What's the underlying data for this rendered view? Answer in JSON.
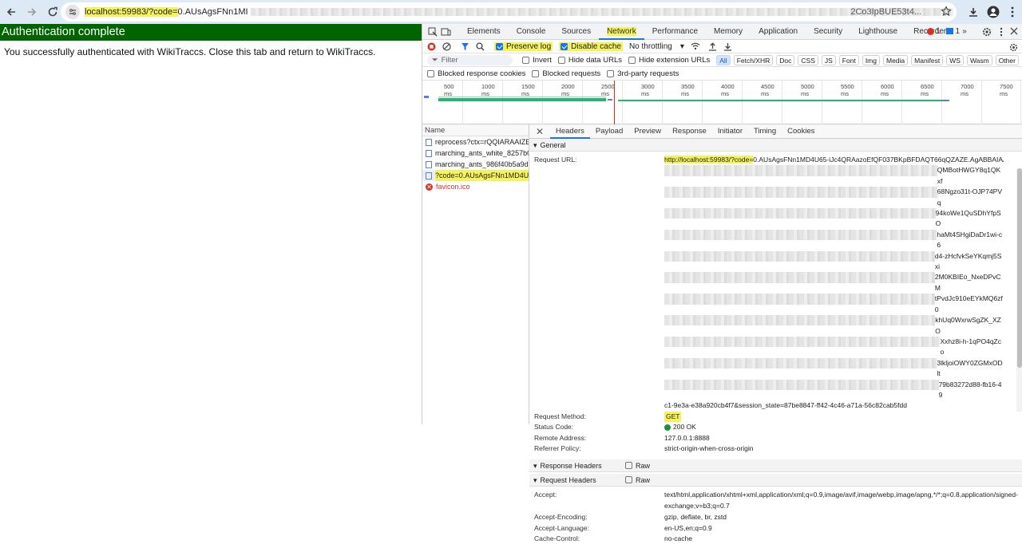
{
  "browser": {
    "url_highlight": "localhost:59983/?code=",
    "url_rest": "0.AUsAgsFNn1MI",
    "url_tail": "2Co3IpBUE53t4..."
  },
  "page": {
    "title": "Authentication complete",
    "message": "You successfully authenticated with WikiTraccs. Close this tab and return to WikiTraccs."
  },
  "devtools": {
    "tabs": [
      "Elements",
      "Console",
      "Sources",
      "Network",
      "Performance",
      "Memory",
      "Application",
      "Security",
      "Lighthouse",
      "Recorder"
    ],
    "active_tab": "Network",
    "more": "»",
    "errors": "1",
    "messages": "1",
    "toolbar": {
      "preserve_log": "Preserve log",
      "disable_cache": "Disable cache",
      "throttling": "No throttling"
    },
    "filter": {
      "placeholder": "Filter",
      "invert": "Invert",
      "hide_data_urls": "Hide data URLs",
      "hide_extension_urls": "Hide extension URLs",
      "types": [
        "All",
        "Fetch/XHR",
        "Doc",
        "CSS",
        "JS",
        "Font",
        "Img",
        "Media",
        "Manifest",
        "WS",
        "Wasm",
        "Other"
      ]
    },
    "options": {
      "blocked_cookies": "Blocked response cookies",
      "blocked_requests": "Blocked requests",
      "third_party": "3rd-party requests"
    },
    "timeline_ticks": [
      "500 ms",
      "1000 ms",
      "1500 ms",
      "2000 ms",
      "2500 ms",
      "3000 ms",
      "3500 ms",
      "4000 ms",
      "4500 ms",
      "5000 ms",
      "5500 ms",
      "6000 ms",
      "6500 ms",
      "7000 ms",
      "7500 ms"
    ],
    "request_list": {
      "header": "Name",
      "items": [
        {
          "name": "reprocess?ctx=rQQIARAAIZE9...",
          "type": "doc"
        },
        {
          "name": "marching_ants_white_8257b07...",
          "type": "doc"
        },
        {
          "name": "marching_ants_986f40b5a9dc7...",
          "type": "doc"
        },
        {
          "name": "?code=0.AUsAgsFNn1MD4U6...",
          "type": "doc",
          "selected": true
        },
        {
          "name": "favicon.ico",
          "type": "error"
        }
      ]
    },
    "detail": {
      "tabs": [
        "Headers",
        "Payload",
        "Preview",
        "Response",
        "Initiator",
        "Timing",
        "Cookies"
      ],
      "active_tab": "Headers",
      "general_label": "General",
      "general": {
        "request_url_label": "Request URL:",
        "request_url_highlight": "http://localhost:59983/?code=",
        "request_url_first": "0.AUsAgsFNn1MD4U65-iJc4QRAazoEfQF037BKpBFDAQT66qQZAZE.AgABBAIAAAApTwJmzX",
        "request_url_fragments": [
          "QMBotHWGY8q1QKxf",
          "68Ngzo31t-OJP74PVq",
          "94koWe1QuSDhYfpSO",
          "haMt4SHgiDaDr1wi-c6",
          "d4-zHcfvkSeYKqmj5Sxi",
          "2M0KBIEo_NxeDPvCM",
          "tPvdJc910eEYkMQ6zf0",
          "khUq0WxrwSgZK_XZO",
          "Xxhz8i-h-1qPO4qZco",
          "3lkljoiOWY0ZGMxODlt",
          "79b83272d88-fb16-49"
        ],
        "request_url_last": "c1-9e3a-e38a920cb4f7&session_state=87be8847-ff42-4c46-a71a-56c82cab5fdd",
        "method_label": "Request Method:",
        "method": "GET",
        "status_label": "Status Code:",
        "status": "200 OK",
        "remote_label": "Remote Address:",
        "remote": "127.0.0.1:8888",
        "referrer_label": "Referrer Policy:",
        "referrer": "strict-origin-when-cross-origin"
      },
      "response_headers_label": "Response Headers",
      "request_headers_label": "Request Headers",
      "raw_label": "Raw",
      "request_headers": [
        {
          "k": "Accept:",
          "v": "text/html,application/xhtml+xml,application/xml;q=0.9,image/avif,image/webp,image/apng,*/*;q=0.8,application/signed-exchange;v=b3;q=0.7"
        },
        {
          "k": "Accept-Encoding:",
          "v": "gzip, deflate, br, zstd"
        },
        {
          "k": "Accept-Language:",
          "v": "en-US,en;q=0.9"
        },
        {
          "k": "Cache-Control:",
          "v": "no-cache"
        }
      ]
    }
  }
}
